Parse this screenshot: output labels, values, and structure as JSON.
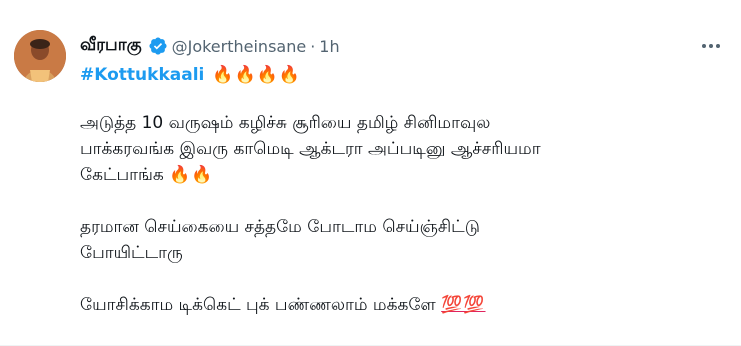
{
  "tweet": {
    "display_name": "வீரபாகு",
    "handle": "@Jokertheinsane",
    "separator": "·",
    "time": "1h",
    "hashtag": "#Kottukkaali",
    "hashtag_emoji": "🔥🔥🔥🔥",
    "paragraphs": [
      {
        "lines": [
          "அடுத்த 10 வருஷம் கழிச்சு சூரியை தமிழ் சினிமாவுல",
          "பாக்கரவங்க இவரு காமெடி ஆக்டரா அப்படினு ஆச்சரியமா",
          "கேட்பாங்க"
        ],
        "trailing_emoji": "🔥🔥"
      },
      {
        "lines": [
          "தரமான செய்கையை சத்தமே போடாம செய்ஞ்சிட்டு",
          "போயிட்டாரு"
        ],
        "trailing_emoji": ""
      },
      {
        "lines": [
          "யோசிக்காம டிக்கெட் புக் பண்ணலாம் மக்களே"
        ],
        "trailing_emoji": "💯💯"
      }
    ]
  },
  "icons": {
    "verified": "verified-badge-icon",
    "more": "more-options-icon"
  },
  "colors": {
    "link": "#1d9bf0",
    "secondary_text": "#536471",
    "primary_text": "#0f1419",
    "verified_badge": "#1d9bf0"
  }
}
